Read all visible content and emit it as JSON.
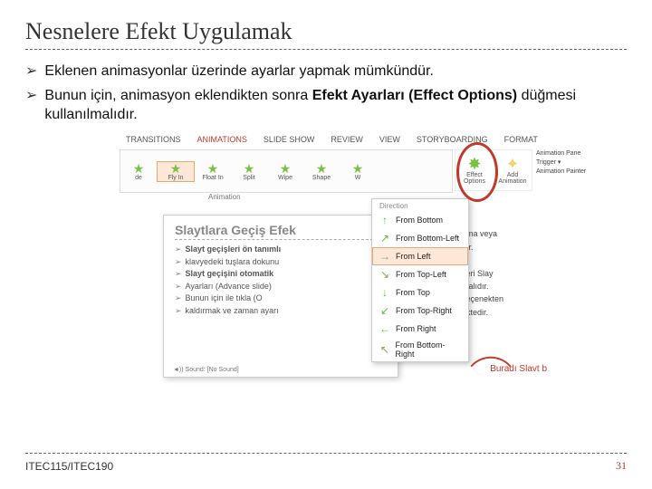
{
  "title": "Nesnelere Efekt Uygulamak",
  "bullets": [
    {
      "text_plain": "Eklenen animasyonlar üzerinde ayarlar yapmak mümkündür."
    },
    {
      "text_before": "Bunun için, animasyon eklendikten sonra ",
      "bold": "Efekt Ayarları (Effect Options)",
      "text_after": " düğmesi kullanılmalıdır."
    }
  ],
  "figure": {
    "tabs": [
      "TRANSITIONS",
      "ANIMATIONS",
      "SLIDE SHOW",
      "REVIEW",
      "VIEW",
      "STORYBOARDING",
      "FORMAT"
    ],
    "anim_items": [
      "de",
      "Fly In",
      "Float In",
      "Split",
      "Wipe",
      "Shape",
      "W"
    ],
    "gallery_label": "Animation",
    "effect_options_label": "Effect Options",
    "add_animation_label": "Add Animation",
    "advanced_group": [
      "Animation Pane",
      "Trigger ▾",
      "Animation Painter"
    ],
    "dropdown_header": "Direction",
    "dropdown_items": [
      {
        "icon": "↑",
        "label": "From Bottom"
      },
      {
        "icon": "↗",
        "label": "From Bottom-Left"
      },
      {
        "icon": "→",
        "label": "From Left",
        "selected": true
      },
      {
        "icon": "↘",
        "label": "From Top-Left"
      },
      {
        "icon": "↓",
        "label": "From Top"
      },
      {
        "icon": "↙",
        "label": "From Top-Right"
      },
      {
        "icon": "←",
        "label": "From Right"
      },
      {
        "icon": "↖",
        "label": "From Bottom-Right"
      }
    ],
    "mini_slide_title": "Slaytlara Geçiş Efek",
    "mini_bullets": [
      "Slayt geçişleri ön tanımlı",
      "klavyedeki tuşlara dokunu",
      "Slayt geçişini otomatik",
      "Ayarları (Advance slide)",
      "Bunun için ile tıkla (O",
      "kaldırmak ve zaman ayarı"
    ],
    "mini_sound": "◄)) Sound:  [No Sound]",
    "right_fragment": [
      "ama veya",
      "dır.",
      "n",
      "İleri Slay",
      "malıdır.",
      "seçenekten",
      "ektedir."
    ],
    "callout": "Buradı Slavt b"
  },
  "footer": {
    "course": "ITEC115/ITEC190",
    "page": "31"
  }
}
